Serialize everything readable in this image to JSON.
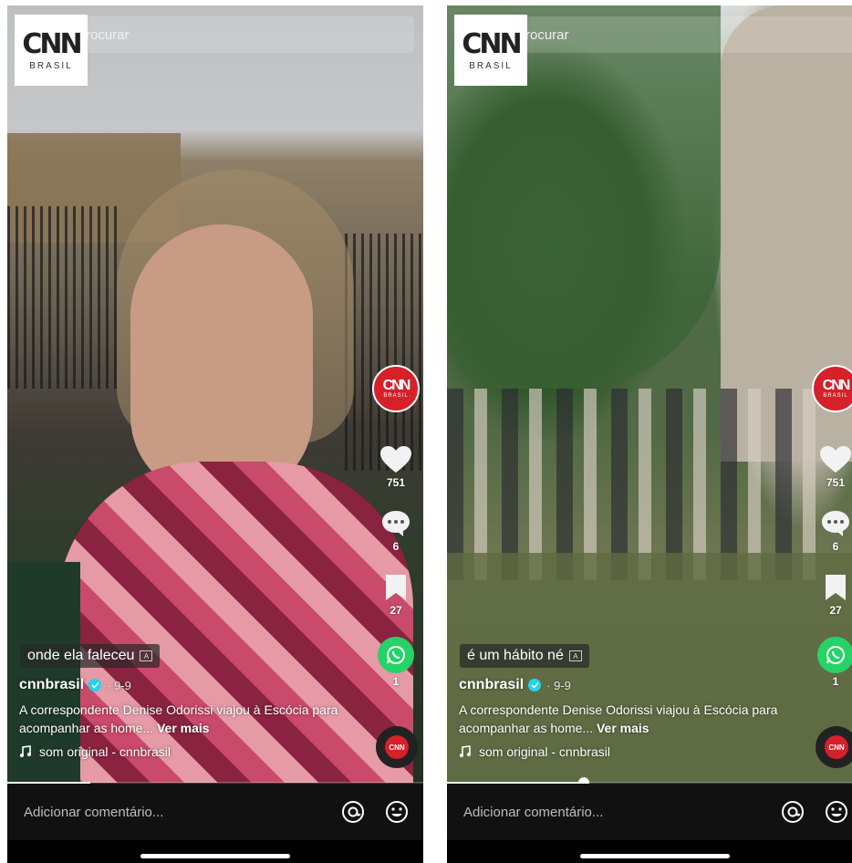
{
  "screens": [
    {
      "search": {
        "placeholder": "Procurar"
      },
      "logo": {
        "mark": "CNN",
        "sub": "BRASIL"
      },
      "avatar": {
        "mark": "CNN",
        "sub": "BRASIL"
      },
      "likes": "751",
      "comments": "6",
      "saves": "27",
      "shares": "1",
      "caption": "onde ela faleceu",
      "username": "cnnbrasil",
      "date": "· 9-9",
      "description": "A correspondente Denise Odorissi viajou à Escócia para acompanhar as home...",
      "see_more": "Ver mais",
      "music": "som original - cnnbrasil",
      "progress": 0.2,
      "comment_placeholder": "Adicionar comentário..."
    },
    {
      "search": {
        "placeholder": "Procurar"
      },
      "logo": {
        "mark": "CNN",
        "sub": "BRASIL"
      },
      "avatar": {
        "mark": "CNN",
        "sub": "BRASIL"
      },
      "likes": "751",
      "comments": "6",
      "saves": "27",
      "shares": "1",
      "caption": "é um hábito né",
      "username": "cnnbrasil",
      "date": "· 9-9",
      "description": "A correspondente Denise Odorissi viajou à Escócia para acompanhar as home...",
      "see_more": "Ver mais",
      "music": "som original - cnnbrasil",
      "progress": 0.33,
      "comment_placeholder": "Adicionar comentário..."
    }
  ],
  "colors": {
    "brand_red": "#d6202a",
    "verified": "#20d5ec",
    "whatsapp": "#25d366",
    "bar": "#111111"
  },
  "icons": [
    "back-icon",
    "search-icon",
    "heart-icon",
    "comment-icon",
    "bookmark-icon",
    "whatsapp-icon",
    "verified-icon",
    "music-note-icon",
    "at-icon",
    "emoji-icon",
    "translate-icon"
  ]
}
